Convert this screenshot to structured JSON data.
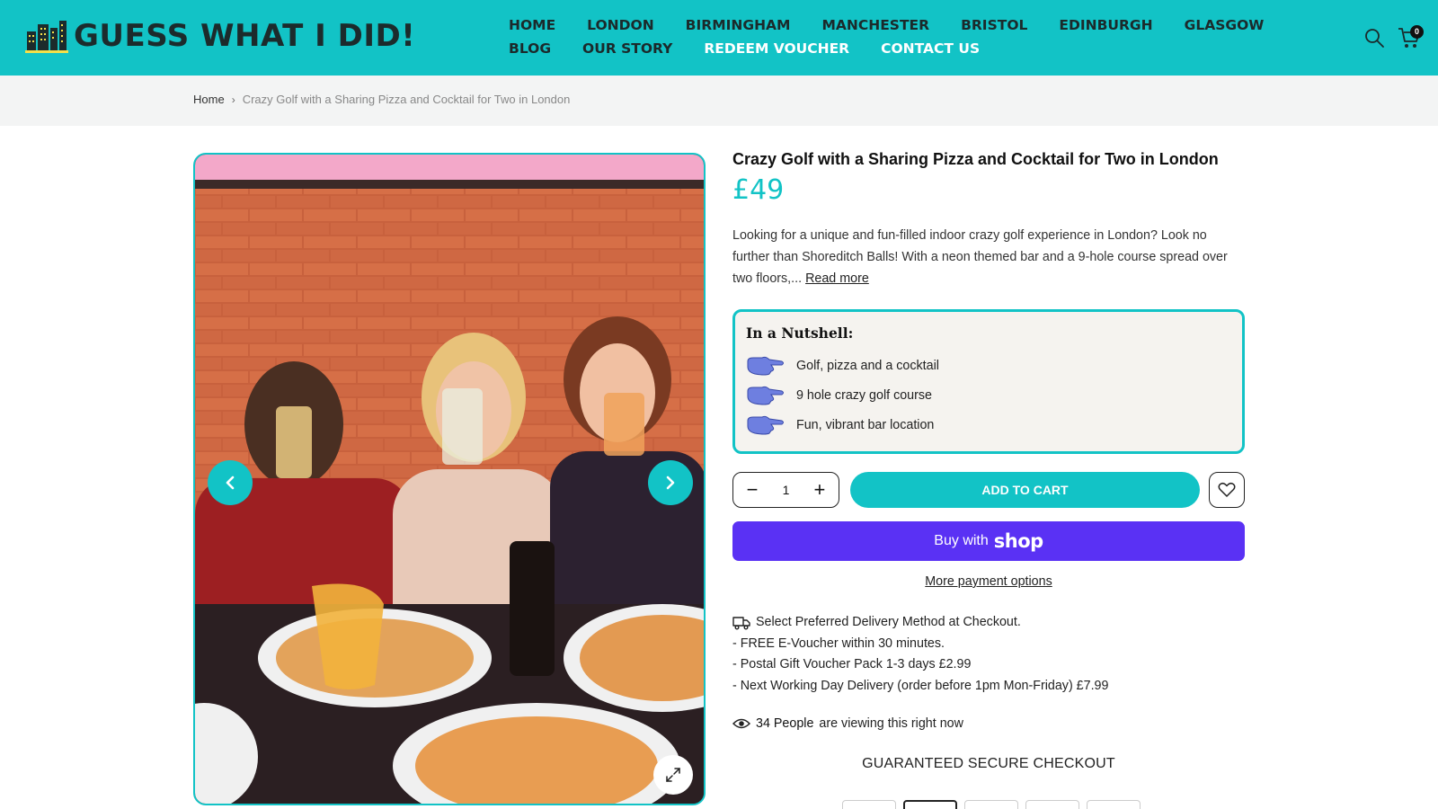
{
  "brand": {
    "logo_text": "GUESS WHAT I DID!",
    "accent_color": "#12c3c6",
    "shop_color": "#5a31f4"
  },
  "nav": {
    "items": [
      {
        "label": "HOME",
        "style": "dark"
      },
      {
        "label": "LONDON",
        "style": "dark"
      },
      {
        "label": "BIRMINGHAM",
        "style": "dark"
      },
      {
        "label": "MANCHESTER",
        "style": "dark"
      },
      {
        "label": "BRISTOL",
        "style": "dark"
      },
      {
        "label": "EDINBURGH",
        "style": "dark"
      },
      {
        "label": "GLASGOW",
        "style": "dark"
      },
      {
        "label": "BLOG",
        "style": "dark"
      },
      {
        "label": "OUR STORY",
        "style": "dark"
      },
      {
        "label": "REDEEM VOUCHER",
        "style": "light"
      },
      {
        "label": "CONTACT US",
        "style": "light"
      }
    ]
  },
  "header": {
    "search_icon": "search-icon",
    "cart_icon": "cart-icon",
    "cart_count": "0"
  },
  "breadcrumb": {
    "home": "Home",
    "current": "Crazy Golf with a Sharing Pizza and Cocktail for Two in London"
  },
  "product": {
    "title": "Crazy Golf with a Sharing Pizza and Cocktail for Two in London",
    "price": "£49",
    "description": "Looking for a unique and fun-filled indoor crazy golf experience in London? Look no further than Shoreditch Balls! With a neon themed bar and a 9-hole course spread over two floors,...",
    "read_more": "Read more"
  },
  "nutshell": {
    "title": "In a Nutshell:",
    "items": [
      "Golf, pizza and a cocktail",
      "9 hole crazy golf course",
      "Fun, vibrant bar location"
    ]
  },
  "cart": {
    "quantity": "1",
    "minus": "−",
    "plus": "+",
    "add_to_cart": "ADD TO CART",
    "wishlist_icon": "heart-icon"
  },
  "payment": {
    "buy_with": "Buy with",
    "shop_brand": "shop",
    "more_options": "More payment options"
  },
  "delivery": {
    "heading": "Select Preferred Delivery Method at Checkout.",
    "lines": [
      "- FREE E-Voucher within 30 minutes.",
      "- Postal Gift Voucher Pack 1-3 days £2.99",
      "- Next Working Day Delivery (order before 1pm Mon-Friday) £7.99"
    ]
  },
  "viewing": {
    "count": "34 People",
    "suffix": "are viewing this right now"
  },
  "secure": {
    "label": "GUARANTEED SECURE CHECKOUT"
  }
}
